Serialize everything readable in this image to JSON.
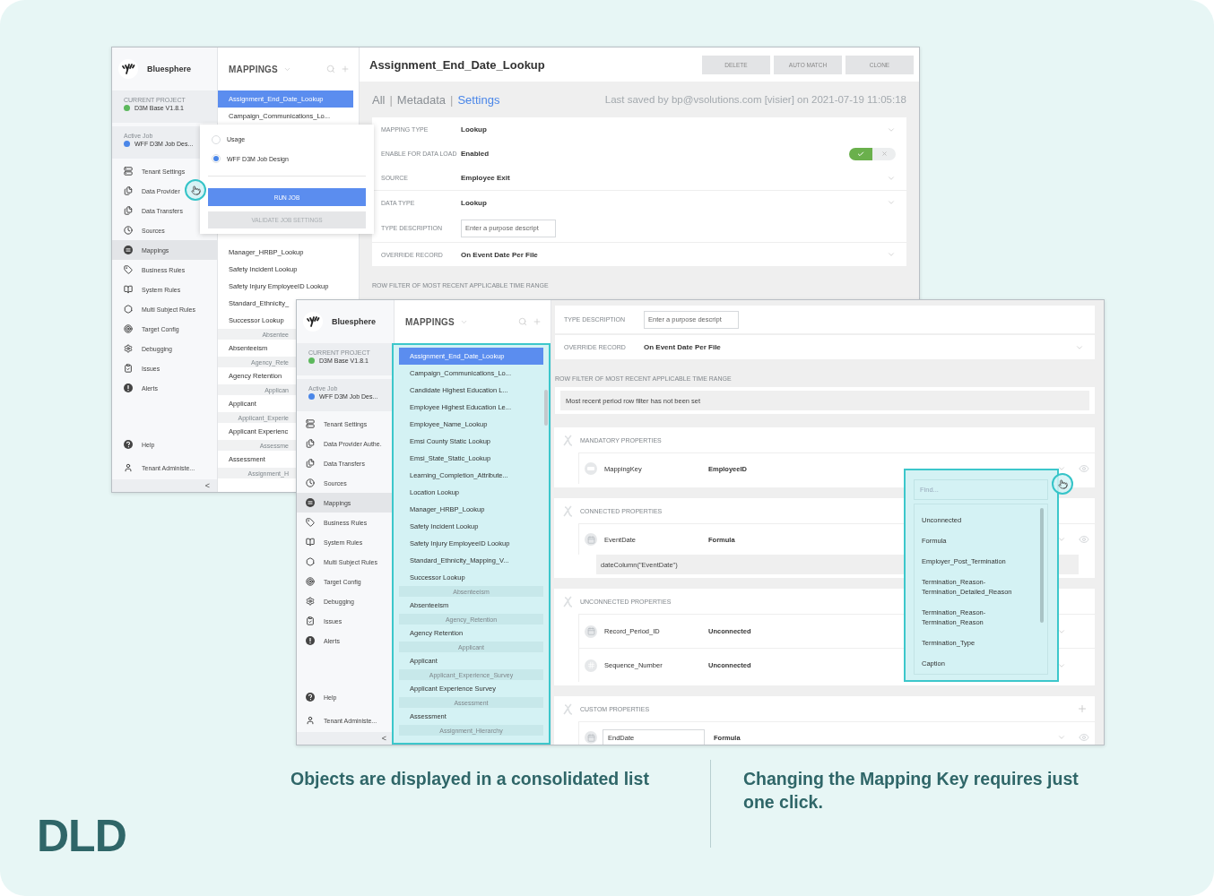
{
  "back_window": {
    "sidebar": {
      "brand": "Bluesphere",
      "project_label": "CURRENT PROJECT",
      "project": "D3M Base V1.8.1",
      "job_label": "Active Job",
      "job": "WFF D3M Job Des...",
      "nav": [
        {
          "label": "Tenant Settings",
          "selected": false
        },
        {
          "label": "Data Provider",
          "selected": false
        },
        {
          "label": "Data Transfers",
          "selected": false
        },
        {
          "label": "Sources",
          "selected": false
        },
        {
          "label": "Mappings",
          "selected": true
        },
        {
          "label": "Business Rules",
          "selected": false
        },
        {
          "label": "System Rules",
          "selected": false
        },
        {
          "label": "Multi Subject Rules",
          "selected": false
        },
        {
          "label": "Target Config",
          "selected": false
        },
        {
          "label": "Debugging",
          "selected": false
        },
        {
          "label": "Issues",
          "selected": false
        },
        {
          "label": "Alerts",
          "selected": false
        }
      ],
      "footer": [
        "Help",
        "Tenant Administe..."
      ],
      "collapse": "<"
    },
    "list": {
      "title": "MAPPINGS",
      "highlighted": false,
      "items": [
        {
          "kind": "item",
          "label": "Assignment_End_Date_Lookup",
          "selected": true
        },
        {
          "kind": "item",
          "label": "Campaign_Communications_Lo...",
          "selected": false
        },
        {
          "kind": "item",
          "label": "Manager_HRBP_Lookup",
          "selected": false
        },
        {
          "kind": "item",
          "label": "Safety Incident Lookup",
          "selected": false
        },
        {
          "kind": "item",
          "label": "Safety Injury EmployeeID Lookup",
          "selected": false
        },
        {
          "kind": "item",
          "label": "Standard_Ethnicity_",
          "selected": false
        },
        {
          "kind": "item",
          "label": "Successor Lookup",
          "selected": false
        },
        {
          "kind": "group",
          "label": "Absentee"
        },
        {
          "kind": "item",
          "label": "Absenteeism",
          "selected": false
        },
        {
          "kind": "group",
          "label": "Agency_Rete"
        },
        {
          "kind": "item",
          "label": "Agency Retention",
          "selected": false
        },
        {
          "kind": "group",
          "label": "Applican"
        },
        {
          "kind": "item",
          "label": "Applicant",
          "selected": false
        },
        {
          "kind": "group",
          "label": "Applicant_Experie"
        },
        {
          "kind": "item",
          "label": "Applicant Experienc",
          "selected": false
        },
        {
          "kind": "group",
          "label": "Assessme"
        },
        {
          "kind": "item",
          "label": "Assessment",
          "selected": false
        },
        {
          "kind": "group",
          "label": "Assignment_H"
        }
      ]
    },
    "job_popup": {
      "options": [
        {
          "label": "Usage",
          "selected": false
        },
        {
          "label": "WFF D3M Job Design",
          "selected": true
        }
      ],
      "run": "RUN JOB",
      "validate": {
        "label": "VALIDATE JOB SETTINGS",
        "disabled": true
      }
    },
    "detail": {
      "title": "Assignment_End_Date_Lookup",
      "actions": [
        "DELETE",
        "AUTO MATCH",
        "CLONE"
      ],
      "tabs": [
        {
          "label": "All",
          "selected": false
        },
        {
          "label": "Metadata",
          "selected": false
        },
        {
          "label": "Settings",
          "selected": true
        }
      ],
      "tab_separator": "|",
      "last_saved": "Last saved by bp@vsolutions.com [visier] on 2021-07-19 11:05:18",
      "fields": [
        {
          "kind": "select",
          "label": "MAPPING TYPE",
          "value": "Lookup"
        },
        {
          "kind": "toggle",
          "label": "ENABLE FOR DATA LOAD",
          "value": "Enabled",
          "on": true
        },
        {
          "kind": "select",
          "label": "SOURCE",
          "value": "Employee Exit"
        },
        {
          "kind": "select",
          "label": "DATA TYPE",
          "value": "Lookup"
        },
        {
          "kind": "input",
          "label": "TYPE DESCRIPTION",
          "placeholder": "Enter a purpose descript"
        },
        {
          "kind": "select",
          "label": "OVERRIDE RECORD",
          "value": "On Event Date Per File"
        }
      ],
      "section_label": "ROW FILTER OF MOST RECENT APPLICABLE TIME RANGE"
    }
  },
  "front_window": {
    "sidebar": {
      "brand": "Bluesphere",
      "project_label": "CURRENT PROJECT",
      "project": "D3M Base V1.8.1",
      "job_label": "Active Job",
      "job": "WFF D3M Job Des...",
      "nav": [
        {
          "label": "Tenant Settings",
          "selected": false
        },
        {
          "label": "Data Provider Authe.",
          "selected": false
        },
        {
          "label": "Data Transfers",
          "selected": false
        },
        {
          "label": "Sources",
          "selected": false
        },
        {
          "label": "Mappings",
          "selected": true
        },
        {
          "label": "Business Rules",
          "selected": false
        },
        {
          "label": "System Rules",
          "selected": false
        },
        {
          "label": "Multi Subject Rules",
          "selected": false
        },
        {
          "label": "Target Config",
          "selected": false
        },
        {
          "label": "Debugging",
          "selected": false
        },
        {
          "label": "Issues",
          "selected": false
        },
        {
          "label": "Alerts",
          "selected": false
        }
      ],
      "footer": [
        "Help",
        "Tenant Administe..."
      ],
      "collapse": "<"
    },
    "list": {
      "title": "MAPPINGS",
      "highlighted": true,
      "items": [
        {
          "kind": "item",
          "label": "Assignment_End_Date_Lookup",
          "selected": true
        },
        {
          "kind": "item",
          "label": "Campaign_Communications_Lo...",
          "selected": false
        },
        {
          "kind": "item",
          "label": "Candidate Highest Education L...",
          "selected": false
        },
        {
          "kind": "item",
          "label": "Employee Highest Education Le...",
          "selected": false
        },
        {
          "kind": "item",
          "label": "Employee_Name_Lookup",
          "selected": false
        },
        {
          "kind": "item",
          "label": "Emsi County Static Lookup",
          "selected": false
        },
        {
          "kind": "item",
          "label": "Emsi_State_Static_Lookup",
          "selected": false
        },
        {
          "kind": "item",
          "label": "Learning_Completion_Attribute...",
          "selected": false
        },
        {
          "kind": "item",
          "label": "Location Lookup",
          "selected": false
        },
        {
          "kind": "item",
          "label": "Manager_HRBP_Lookup",
          "selected": false
        },
        {
          "kind": "item",
          "label": "Safety Incident Lookup",
          "selected": false
        },
        {
          "kind": "item",
          "label": "Safety Injury EmployeeID Lookup",
          "selected": false
        },
        {
          "kind": "item",
          "label": "Standard_Ethnicity_Mapping_V...",
          "selected": false
        },
        {
          "kind": "item",
          "label": "Successor Lookup",
          "selected": false
        },
        {
          "kind": "group",
          "label": "Absenteeism"
        },
        {
          "kind": "item",
          "label": "Absenteeism",
          "selected": false
        },
        {
          "kind": "group",
          "label": "Agency_Retention"
        },
        {
          "kind": "item",
          "label": "Agency Retention",
          "selected": false
        },
        {
          "kind": "group",
          "label": "Applicant"
        },
        {
          "kind": "item",
          "label": "Applicant",
          "selected": false
        },
        {
          "kind": "group",
          "label": "Applicant_Experience_Survey"
        },
        {
          "kind": "item",
          "label": "Applicant Experience Survey",
          "selected": false
        },
        {
          "kind": "group",
          "label": "Assessment"
        },
        {
          "kind": "item",
          "label": "Assessment",
          "selected": false
        },
        {
          "kind": "group",
          "label": "Assignment_Hierarchy"
        }
      ]
    },
    "detail": {
      "fields": [
        {
          "kind": "input",
          "label": "TYPE DESCRIPTION",
          "placeholder": "Enter a purpose descript"
        },
        {
          "kind": "select",
          "label": "OVERRIDE RECORD",
          "value": "On Event Date Per File"
        }
      ],
      "row_filter": {
        "label": "ROW FILTER OF MOST RECENT APPLICABLE TIME RANGE",
        "text": "Most recent period row filter has not been set"
      },
      "property_groups": [
        {
          "title": "MANDATORY PROPERTIES",
          "addable": false,
          "properties": [
            {
              "kind": "text",
              "name": "MappingKey",
              "value": "EmployeeID",
              "editable": false,
              "visible": true
            }
          ]
        },
        {
          "title": "CONNECTED PROPERTIES",
          "addable": false,
          "properties": [
            {
              "kind": "date",
              "name": "EventDate",
              "value": "Formula",
              "formula": "dateColumn(\"EventDate\")",
              "editable": false,
              "visible": true
            }
          ]
        },
        {
          "title": "UNCONNECTED PROPERTIES",
          "addable": false,
          "properties": [
            {
              "kind": "date",
              "name": "Record_Period_ID",
              "value": "Unconnected",
              "editable": false,
              "visible": false
            },
            {
              "kind": "number",
              "name": "Sequence_Number",
              "value": "Unconnected",
              "editable": false,
              "visible": false
            }
          ]
        },
        {
          "title": "CUSTOM PROPERTIES",
          "addable": true,
          "properties": [
            {
              "kind": "date",
              "name": "EndDate",
              "value": "Formula",
              "editable": true,
              "visible": true
            }
          ]
        }
      ]
    },
    "key_dropdown": {
      "placeholder": "Find...",
      "options": [
        "Unconnected",
        "Formula",
        "Employer_Post_Termination",
        "Termination_Reason-\nTermination_Detailed_Reason",
        "Termination_Reason-\nTermination_Reason",
        "Termination_Type",
        "Caption"
      ]
    }
  },
  "captions": [
    "Objects are displayed in a consolidated list",
    "Changing the Mapping Key requires just one click."
  ],
  "logo": "DLD"
}
